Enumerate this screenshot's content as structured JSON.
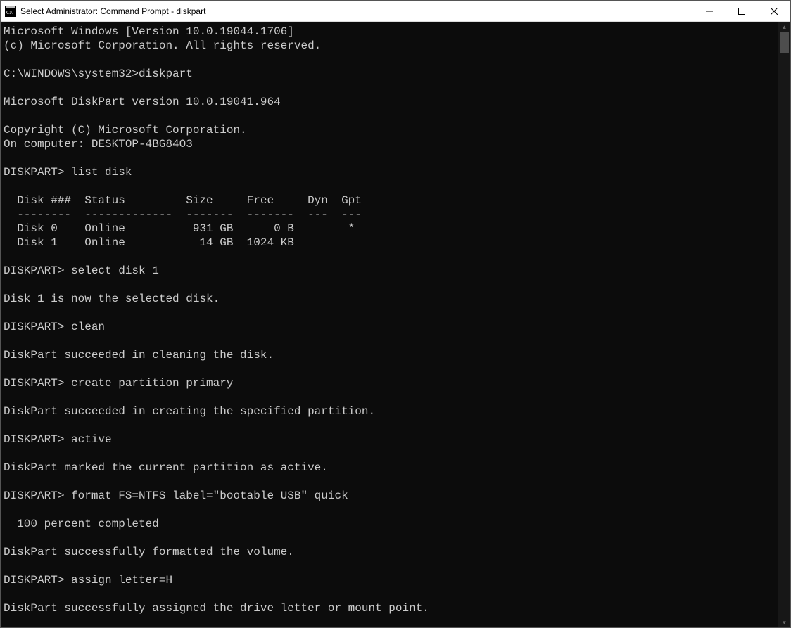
{
  "window": {
    "title": "Select Administrator: Command Prompt - diskpart"
  },
  "terminal": {
    "lines": [
      "Microsoft Windows [Version 10.0.19044.1706]",
      "(c) Microsoft Corporation. All rights reserved.",
      "",
      "C:\\WINDOWS\\system32>diskpart",
      "",
      "Microsoft DiskPart version 10.0.19041.964",
      "",
      "Copyright (C) Microsoft Corporation.",
      "On computer: DESKTOP-4BG84O3",
      "",
      "DISKPART> list disk",
      "",
      "  Disk ###  Status         Size     Free     Dyn  Gpt",
      "  --------  -------------  -------  -------  ---  ---",
      "  Disk 0    Online          931 GB      0 B        *",
      "  Disk 1    Online           14 GB  1024 KB",
      "",
      "DISKPART> select disk 1",
      "",
      "Disk 1 is now the selected disk.",
      "",
      "DISKPART> clean",
      "",
      "DiskPart succeeded in cleaning the disk.",
      "",
      "DISKPART> create partition primary",
      "",
      "DiskPart succeeded in creating the specified partition.",
      "",
      "DISKPART> active",
      "",
      "DiskPart marked the current partition as active.",
      "",
      "DISKPART> format FS=NTFS label=\"bootable USB\" quick",
      "",
      "  100 percent completed",
      "",
      "DiskPart successfully formatted the volume.",
      "",
      "DISKPART> assign letter=H",
      "",
      "DiskPart successfully assigned the drive letter or mount point."
    ]
  }
}
